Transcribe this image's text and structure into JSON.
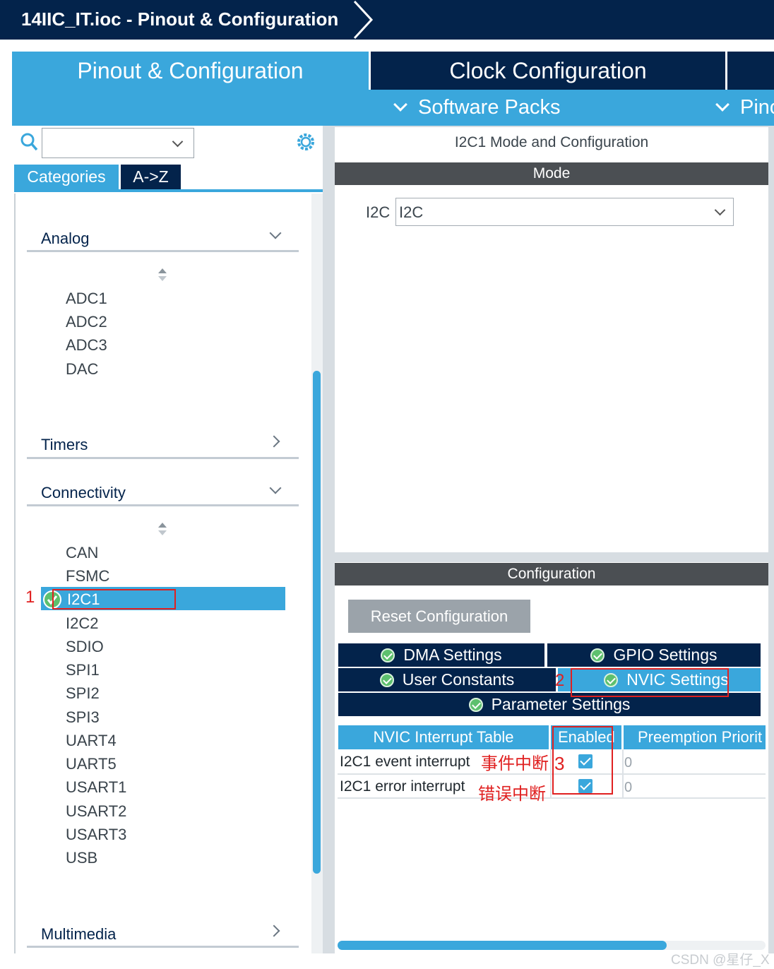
{
  "window": {
    "title": "14IIC_IT.ioc - Pinout & Configuration"
  },
  "main_tabs": {
    "pinout": "Pinout & Configuration",
    "clock": "Clock Configuration"
  },
  "sub_bar": {
    "software_packs": "Software Packs",
    "pinout_partial": "Pinc"
  },
  "left": {
    "category_tab": "Categories",
    "az_tab": "A->Z",
    "sections": {
      "analog": {
        "title": "Analog",
        "items": [
          "ADC1",
          "ADC2",
          "ADC3",
          "DAC"
        ]
      },
      "timers": {
        "title": "Timers"
      },
      "connectivity": {
        "title": "Connectivity",
        "items": [
          "CAN",
          "FSMC",
          "I2C1",
          "I2C2",
          "SDIO",
          "SPI1",
          "SPI2",
          "SPI3",
          "UART4",
          "UART5",
          "USART1",
          "USART2",
          "USART3",
          "USB"
        ],
        "selected": "I2C1"
      },
      "multimedia": {
        "title": "Multimedia"
      }
    }
  },
  "right": {
    "mode_title": "I2C1 Mode and Configuration",
    "mode_header": "Mode",
    "i2c_label": "I2C",
    "i2c_value": "I2C",
    "config_header": "Configuration",
    "reset_button": "Reset Configuration",
    "settings_tabs": {
      "dma": "DMA Settings",
      "gpio": "GPIO Settings",
      "user_constants": "User Constants",
      "nvic": "NVIC Settings",
      "parameter": "Parameter Settings"
    },
    "nvic_table": {
      "headers": [
        "NVIC Interrupt Table",
        "Enabled",
        "Preemption Priorit"
      ],
      "rows": [
        {
          "name": "I2C1 event interrupt",
          "enabled": true,
          "priority": "0"
        },
        {
          "name": "I2C1 error interrupt",
          "enabled": true,
          "priority": "0"
        }
      ]
    }
  },
  "annotations": {
    "step1": "1",
    "step2": "2",
    "step3": "3",
    "event_note": "事件中断",
    "error_note": "错误中断"
  },
  "watermark": "CSDN @星仔_X",
  "colors": {
    "navy": "#03234b",
    "accent_blue": "#3aa7dc",
    "header_gray": "#4b4f53",
    "annotation_red": "#e02020",
    "ok_green": "#5dc06e"
  }
}
